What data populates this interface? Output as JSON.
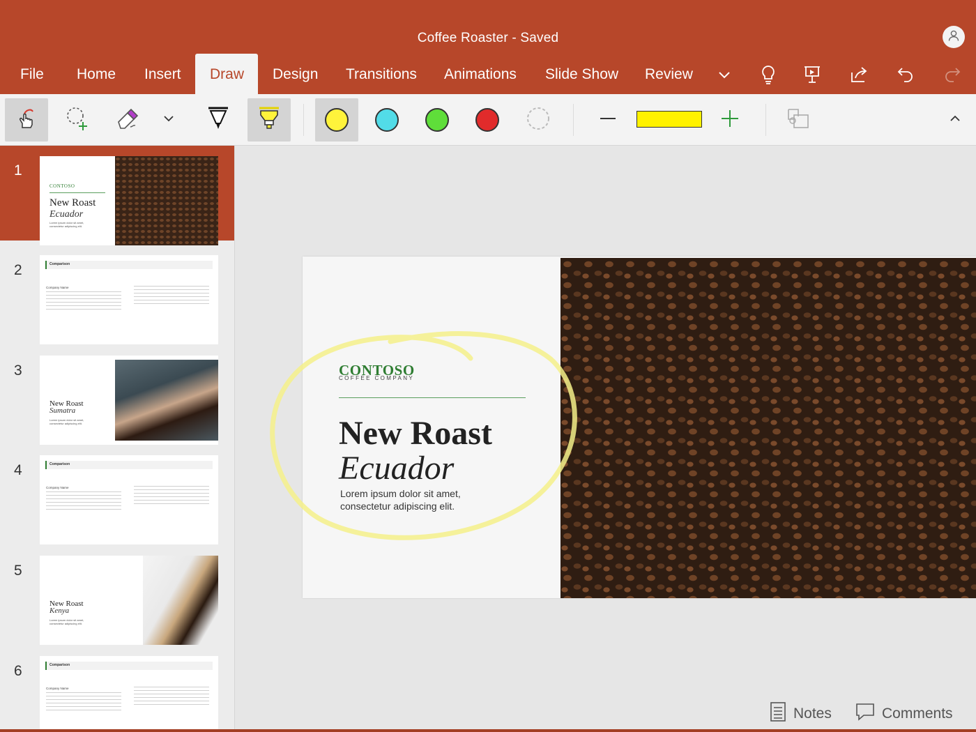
{
  "window": {
    "title": "Coffee Roaster - Saved"
  },
  "account": {
    "icon": "person-icon"
  },
  "tabs": [
    {
      "label": "File"
    },
    {
      "label": "Home"
    },
    {
      "label": "Insert"
    },
    {
      "label": "Draw",
      "active": true
    },
    {
      "label": "Design"
    },
    {
      "label": "Transitions"
    },
    {
      "label": "Animations"
    },
    {
      "label": "Slide Show"
    },
    {
      "label": "Review"
    }
  ],
  "tab_icons": [
    "chevron-down-icon",
    "lightbulb-icon",
    "present-icon",
    "share-icon",
    "undo-icon",
    "redo-icon"
  ],
  "toolbar": {
    "tools": [
      "touch-draw-icon",
      "lasso-select-icon",
      "eraser-icon",
      "chevron-down-icon",
      "pen-icon",
      "highlighter-icon"
    ],
    "selected_tool": "highlighter",
    "colors": [
      "#fff33b",
      "#52dce8",
      "#5fde3a",
      "#e12b2b"
    ],
    "selected_color": "#fff33b",
    "thickness_color": "#fff200",
    "extra": [
      "more-colors-icon",
      "decrease-thickness-icon",
      "increase-thickness-icon",
      "ink-to-shape-icon",
      "collapse-ribbon-icon"
    ]
  },
  "thumbnails": [
    {
      "number": "1",
      "brand": "CONTOSO",
      "title": "New Roast",
      "subtitle": "Ecuador",
      "body": "Lorem ipsum dolor sit amet, consectetur adipiscing elit."
    },
    {
      "number": "2",
      "header": "Comparison",
      "col_title": "Company Name"
    },
    {
      "number": "3",
      "title": "New Roast",
      "subtitle": "Sumatra",
      "body": "Lorem ipsum dolor sit amet, consectetur adipiscing elit."
    },
    {
      "number": "4",
      "header": "Comparison",
      "col_title": "Company Name"
    },
    {
      "number": "5",
      "title": "New Roast",
      "subtitle": "Kenya",
      "body": "Lorem ipsum dolor sit amet, consectetur adipiscing elit."
    },
    {
      "number": "6",
      "header": "Comparison",
      "col_title": "Company Name"
    }
  ],
  "slide": {
    "brand": "CONTOSO",
    "brand_sub": "COFFEE COMPANY",
    "title": "New Roast",
    "subtitle": "Ecuador",
    "body": "Lorem ipsum dolor sit amet, consectetur adipiscing elit."
  },
  "status": {
    "notes": "Notes",
    "comments": "Comments"
  }
}
